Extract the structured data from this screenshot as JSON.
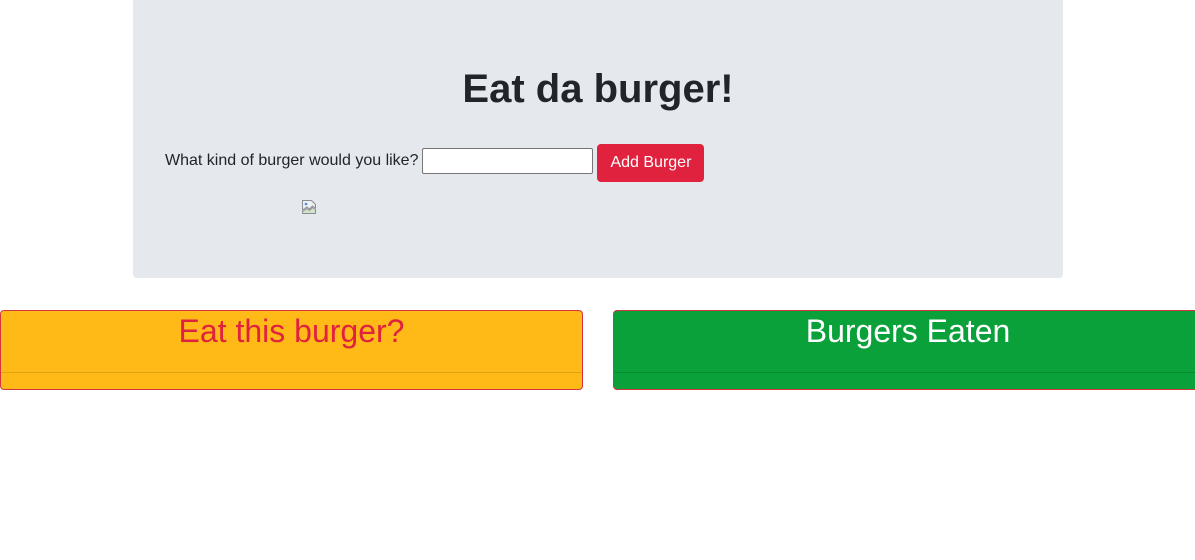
{
  "header": {
    "title": "Eat da burger!"
  },
  "form": {
    "label": "What kind of burger would you like?",
    "input_value": "",
    "input_placeholder": "",
    "submit_label": "Add Burger"
  },
  "image": {
    "icon": "broken-image-icon"
  },
  "columns": {
    "devour": {
      "title": "Eat this burger?",
      "items": []
    },
    "eaten": {
      "title": "Burgers Eaten",
      "items": []
    }
  },
  "colors": {
    "jumbotron_bg": "#e5e8ed",
    "accent_red": "#e0223f",
    "devour_bg": "#ffba17",
    "eaten_bg": "#0aa13b"
  }
}
